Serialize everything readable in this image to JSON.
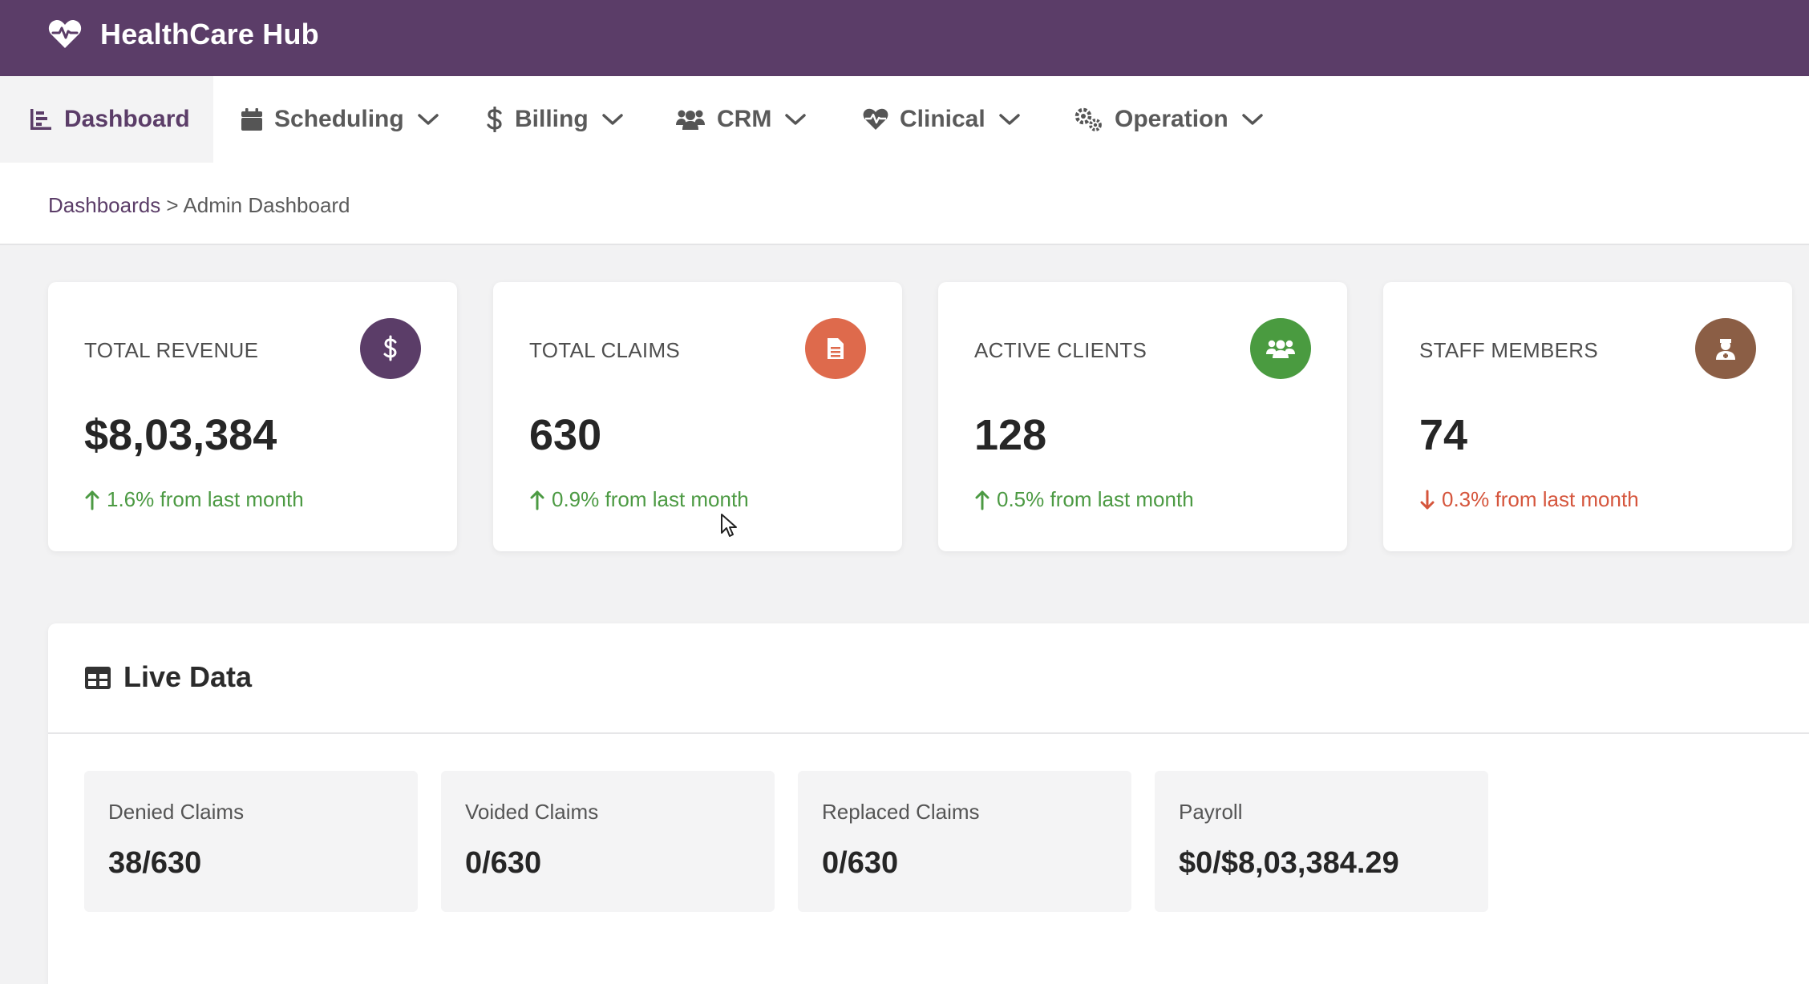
{
  "header": {
    "title": "HealthCare Hub",
    "logo_icon": "heart-pulse-icon",
    "background": "#5b3d68"
  },
  "nav": {
    "items": [
      {
        "label": "Dashboard",
        "icon": "chart-bar-icon",
        "active": true,
        "has_dropdown": false
      },
      {
        "label": "Scheduling",
        "icon": "calendar-icon",
        "active": false,
        "has_dropdown": true
      },
      {
        "label": "Billing",
        "icon": "dollar-icon",
        "active": false,
        "has_dropdown": true
      },
      {
        "label": "CRM",
        "icon": "users-icon",
        "active": false,
        "has_dropdown": true
      },
      {
        "label": "Clinical",
        "icon": "heart-pulse-icon",
        "active": false,
        "has_dropdown": true
      },
      {
        "label": "Operation",
        "icon": "cogs-icon",
        "active": false,
        "has_dropdown": true
      }
    ]
  },
  "breadcrumb": {
    "link": "Dashboards",
    "separator": " > ",
    "current": "Admin Dashboard"
  },
  "stats": [
    {
      "label": "TOTAL REVENUE",
      "value": "$8,03,384",
      "change": "1.6% from last month",
      "direction": "up",
      "icon": "dollar-icon",
      "color": "#5b3d68"
    },
    {
      "label": "TOTAL CLAIMS",
      "value": "630",
      "change": "0.9% from last month",
      "direction": "up",
      "icon": "document-icon",
      "color": "#de6a4c"
    },
    {
      "label": "ACTIVE CLIENTS",
      "value": "128",
      "change": "0.5% from last month",
      "direction": "up",
      "icon": "users-icon",
      "color": "#4a9b40"
    },
    {
      "label": "STAFF MEMBERS",
      "value": "74",
      "change": "0.3% from last month",
      "direction": "down",
      "icon": "user-nurse-icon",
      "color": "#8b5e45"
    }
  ],
  "live": {
    "title": "Live Data",
    "icon": "table-icon",
    "cards": [
      {
        "label": "Denied Claims",
        "value": "38/630"
      },
      {
        "label": "Voided Claims",
        "value": "0/630"
      },
      {
        "label": "Replaced Claims",
        "value": "0/630"
      },
      {
        "label": "Payroll",
        "value": "$0/$8,03,384.29"
      }
    ]
  },
  "colors": {
    "up": "#4c9a43",
    "down": "#d5553c",
    "accent": "#5b3d68"
  }
}
